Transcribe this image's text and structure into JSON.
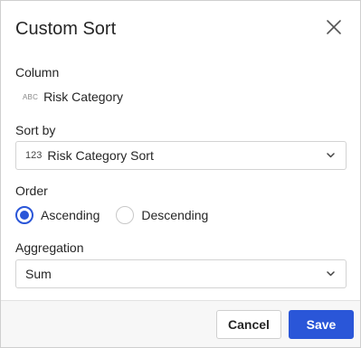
{
  "dialog": {
    "title": "Custom Sort"
  },
  "column": {
    "label": "Column",
    "type_badge": "ABC",
    "name": "Risk Category"
  },
  "sort_by": {
    "label": "Sort by",
    "type_badge": "123",
    "value": "Risk Category Sort"
  },
  "order": {
    "label": "Order",
    "options": [
      {
        "label": "Ascending",
        "checked": true
      },
      {
        "label": "Descending",
        "checked": false
      }
    ]
  },
  "aggregation": {
    "label": "Aggregation",
    "value": "Sum"
  },
  "footer": {
    "cancel_label": "Cancel",
    "save_label": "Save"
  },
  "colors": {
    "accent": "#2a56d8",
    "border": "#d3d3d3",
    "footer_bg": "#f7f7f7"
  },
  "icons": {
    "close": "close-icon",
    "dropdown": "chevron-down-icon"
  }
}
